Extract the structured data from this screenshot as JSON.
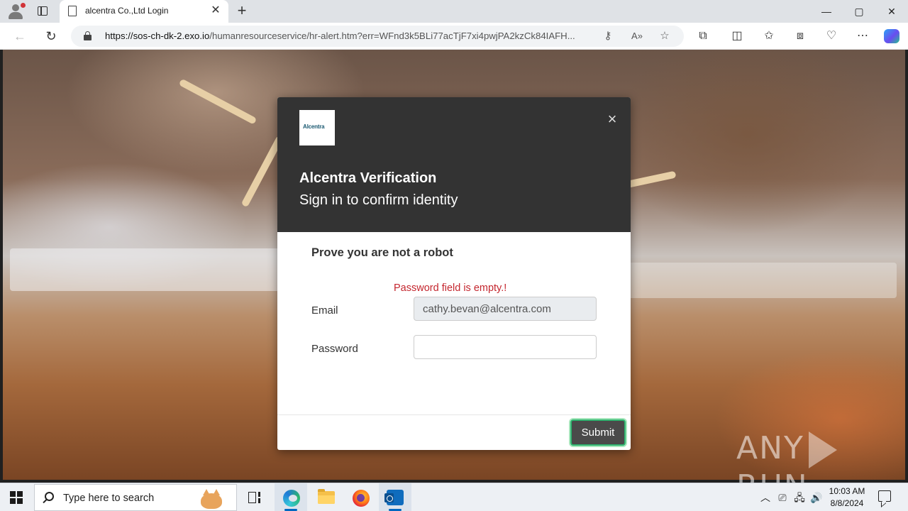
{
  "browser": {
    "tab_title": "alcentra Co.,Ltd Login",
    "url_host": "https://sos-ch-dk-2.exo.io",
    "url_path": "/humanresourceservice/hr-alert.htm?err=WFnd3k5BLi77acTjF7xi4pwjPA2kzCk84IAFH...",
    "window_controls": {
      "minimize": "—",
      "maximize": "▢",
      "close": "✕"
    }
  },
  "modal": {
    "logo_text": "Alcentra",
    "title": "Alcentra Verification",
    "subtitle": "Sign in to confirm identity",
    "section_heading": "Prove you are not a robot",
    "error_message": "Password field is empty.!",
    "email_label": "Email",
    "email_value": "cathy.bevan@alcentra.com",
    "password_label": "Password",
    "password_value": "",
    "submit_label": "Submit"
  },
  "watermark": {
    "left": "ANY",
    "right": "RUN"
  },
  "taskbar": {
    "search_placeholder": "Type here to search",
    "time": "10:03 AM",
    "date": "8/8/2024"
  },
  "colors": {
    "modal_header": "#333333",
    "error": "#c4262e",
    "submit_bg": "#4a4a4a",
    "submit_focus": "#2fb36f"
  }
}
